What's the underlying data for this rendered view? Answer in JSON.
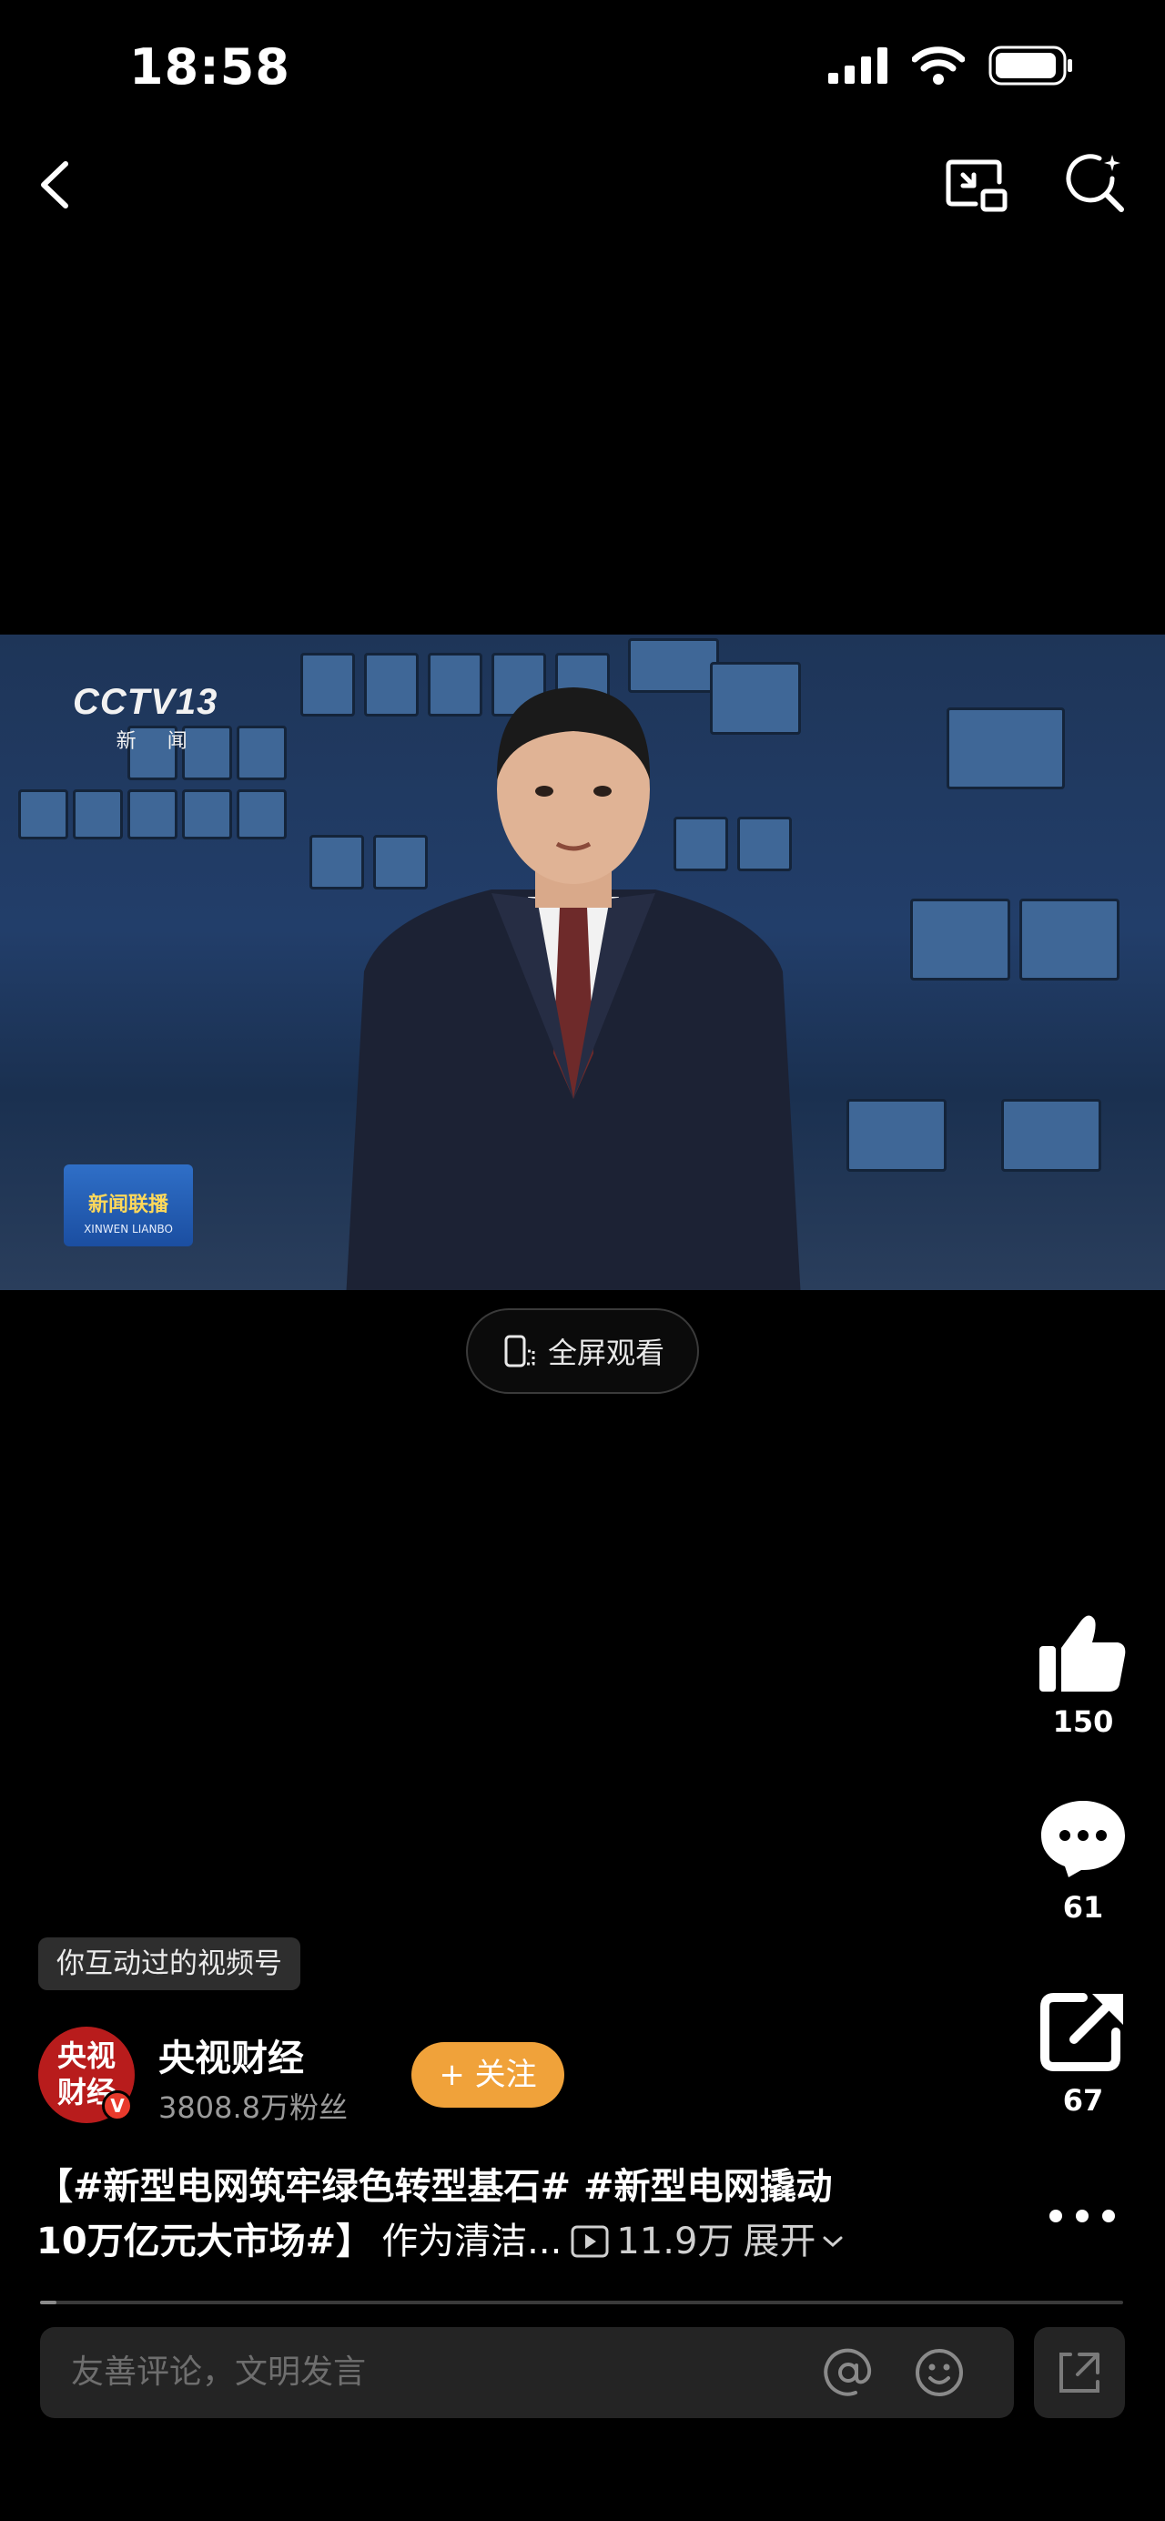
{
  "status_bar": {
    "time": "18:58"
  },
  "video": {
    "channel_logo": "CCTV13",
    "channel_sub": "新 闻",
    "program_title": "新闻联播",
    "program_sub": "XINWEN LIANBO",
    "fullscreen_label": "全屏观看"
  },
  "actions": {
    "likes": "150",
    "comments": "61",
    "shares": "67"
  },
  "badge": "你互动过的视频号",
  "account": {
    "avatar_text": "央视财经",
    "name": "央视财经",
    "followers": "3808.8万粉丝",
    "follow_label": "+ 关注"
  },
  "caption": {
    "line1": "【#新型电网筑牢绿色转型基石# #新型电网撬动",
    "line2": "10万亿元大市场#】",
    "tail": "作为清洁...",
    "views": "11.9万",
    "expand": "展开"
  },
  "progress": {
    "fraction": 0.015
  },
  "comment_input": {
    "placeholder": "友善评论，文明发言"
  },
  "colors": {
    "follow": "#f0a23a",
    "avatar": "#b81c1c",
    "background": "#000000"
  }
}
